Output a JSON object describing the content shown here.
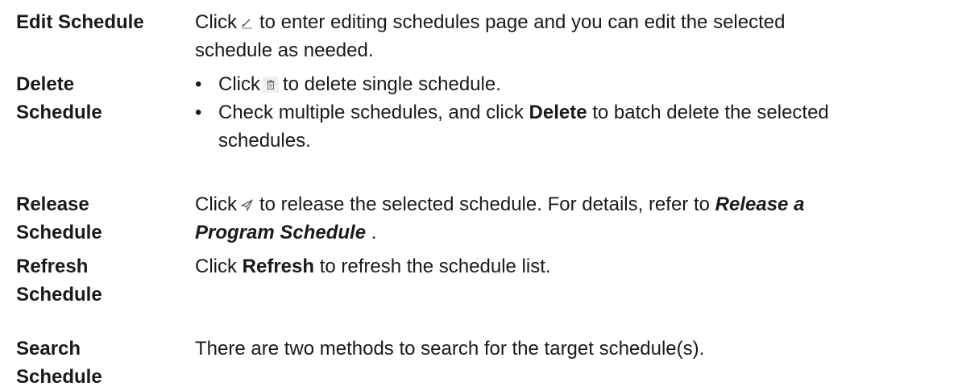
{
  "rows": [
    {
      "term_lines": [
        "Edit Schedule"
      ],
      "desc": {
        "l1_pre": "Click",
        "icon": "pencil-edit-icon",
        "l1_post": "to enter editing schedules page and you can edit the selected",
        "l2": "schedule as needed."
      }
    },
    {
      "term_lines": [
        "Delete",
        "Schedule"
      ],
      "bullets": [
        {
          "marker": "•",
          "pre": "Click",
          "icon": "trash-delete-icon",
          "post": "to delete single schedule."
        },
        {
          "marker": "•",
          "pre": "Check multiple schedules, and click",
          "bold": "Delete",
          "post": "to batch delete the selected",
          "cont": "schedules."
        }
      ]
    },
    {
      "term_lines": [
        "Release",
        "Schedule"
      ],
      "desc": {
        "l1_pre": "Click",
        "icon": "send-release-icon",
        "l1_post": "to release the selected schedule. For details, refer to",
        "l1_ref": "Release a",
        "l2_ref": "Program Schedule",
        "l2_post": "."
      }
    },
    {
      "term_lines": [
        "Refresh",
        "Schedule"
      ],
      "desc": {
        "pre": "Click",
        "bold": "Refresh",
        "post": "to refresh the schedule list."
      }
    },
    {
      "term_lines": [
        "Search",
        "Schedule"
      ],
      "desc": {
        "text": "There are two methods to search for the target schedule(s)."
      }
    }
  ]
}
